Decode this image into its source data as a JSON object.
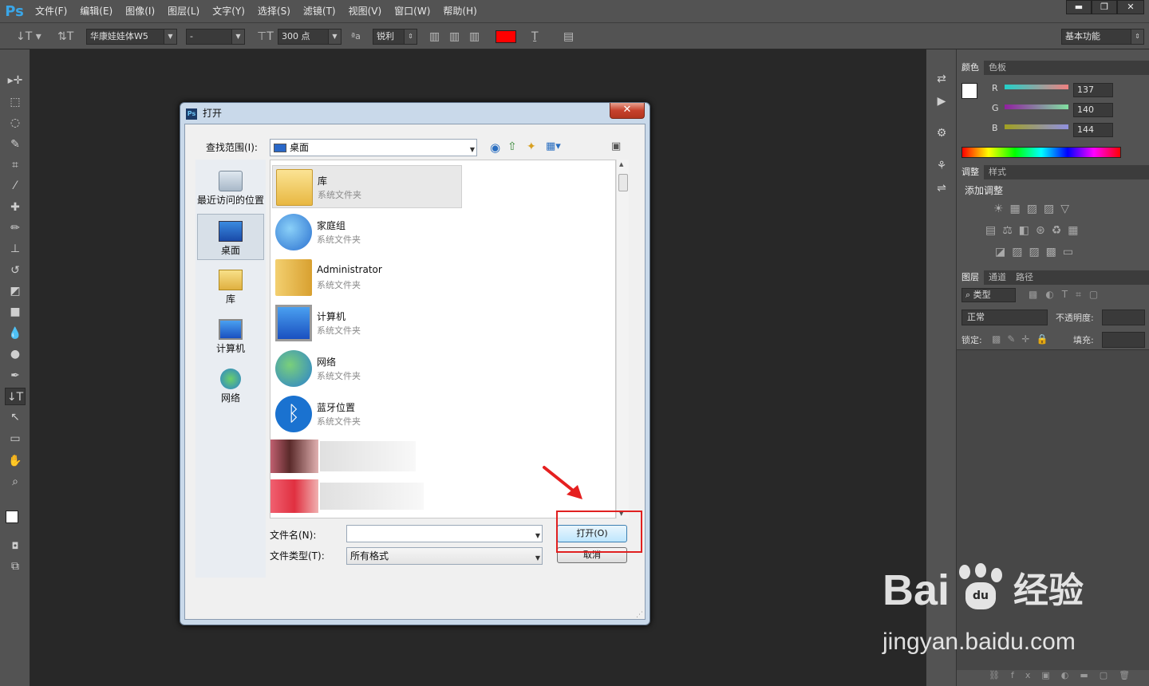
{
  "menubar": {
    "logo": "Ps",
    "items": [
      "文件(F)",
      "编辑(E)",
      "图像(I)",
      "图层(L)",
      "文字(Y)",
      "选择(S)",
      "滤镜(T)",
      "视图(V)",
      "窗口(W)",
      "帮助(H)"
    ],
    "min": "▬",
    "restore": "❐",
    "close": "✕"
  },
  "options": {
    "font_family": "华康娃娃体W5",
    "font_style": "-",
    "font_size": "300 点",
    "aa_mode": "锐利",
    "text_color": "#ff0000",
    "workspace": "基本功能"
  },
  "color_panel": {
    "tabs": [
      "颜色",
      "色板"
    ],
    "r_label": "R",
    "g_label": "G",
    "b_label": "B",
    "r": "137",
    "g": "140",
    "b": "144"
  },
  "adjust_panel": {
    "tabs": [
      "调整",
      "样式"
    ],
    "title": "添加调整"
  },
  "layers_panel": {
    "tabs": [
      "图层",
      "通道",
      "路径"
    ],
    "filter": "类型",
    "blend": "正常",
    "opacity_label": "不透明度:",
    "lock_label": "锁定:",
    "fill_label": "填充:"
  },
  "dialog": {
    "title": "打开",
    "close": "✕",
    "lookin_label": "查找范围(I):",
    "lookin_value": "桌面",
    "places": [
      "最近访问的位置",
      "桌面",
      "库",
      "计算机",
      "网络"
    ],
    "files": [
      {
        "name": "库",
        "type": "系统文件夹"
      },
      {
        "name": "家庭组",
        "type": "系统文件夹"
      },
      {
        "name": "Administrator",
        "type": "系统文件夹"
      },
      {
        "name": "计算机",
        "type": "系统文件夹"
      },
      {
        "name": "网络",
        "type": "系统文件夹"
      },
      {
        "name": "蓝牙位置",
        "type": "系统文件夹"
      }
    ],
    "filename_label": "文件名(N):",
    "filename_value": "",
    "filetype_label": "文件类型(T):",
    "filetype_value": "所有格式",
    "open_button": "打开(O)",
    "cancel_button": "取消"
  },
  "watermark": {
    "brand": "Bai",
    "brand_suffix": "经验",
    "url": "jingyan.baidu.com"
  }
}
